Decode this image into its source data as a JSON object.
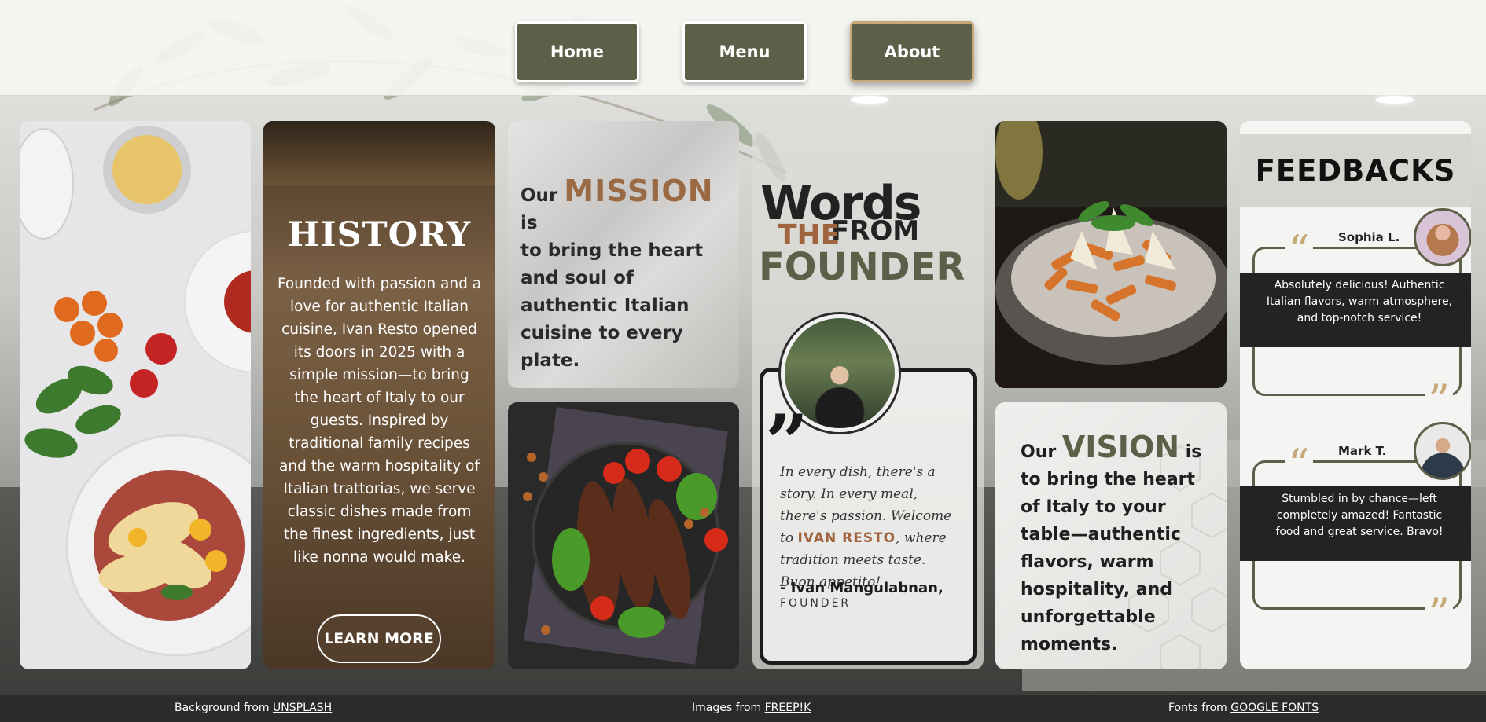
{
  "nav": {
    "items": [
      {
        "label": "Home",
        "active": false
      },
      {
        "label": "Menu",
        "active": false
      },
      {
        "label": "About",
        "active": true
      }
    ]
  },
  "history": {
    "title": "HISTORY",
    "body": "Founded with passion and a love for authentic Italian cuisine, Ivan Resto opened its doors in 2025 with a simple mission—to bring the heart of Italy to our guests. Inspired by traditional family recipes and the warm hospitality of Italian trattorias, we serve classic dishes made from the finest ingredients, just like nonna would make.",
    "button": "LEARN MORE"
  },
  "mission": {
    "prefix": "Our",
    "keyword": "MISSION",
    "suffix": "is",
    "body": "to bring the heart and soul of authentic Italian cuisine to every plate."
  },
  "founder": {
    "heading_words": "Words",
    "heading_from": "FROM",
    "heading_the": "THE",
    "heading_founder": "FOUNDER",
    "quote_part1": "In every dish, there's a story. In every meal, there's passion. Welcome to",
    "quote_brand": "IVAN RESTO",
    "quote_part2": ", where tradition meets taste. Buon appetito!",
    "name": "- Ivan Mangulabnan,",
    "role": "FOUNDER"
  },
  "vision": {
    "prefix": "Our",
    "keyword": "VISION",
    "suffix": "is",
    "body": "to bring the heart of Italy to your table—authentic flavors, warm hospitality, and unforgettable moments."
  },
  "feedbacks": {
    "title": "FEEDBACKS",
    "reviews": [
      {
        "name": "Sophia L.",
        "text": "Absolutely delicious! Authentic Italian flavors, warm atmosphere, and top-notch service!"
      },
      {
        "name": "Mark T.",
        "text": "Stumbled in by chance—left completely amazed! Fantastic food and great service. Bravo!"
      }
    ]
  },
  "footer": {
    "bg_prefix": "Background from",
    "bg_link": "UNSPLASH",
    "img_prefix": "Images from",
    "img_link": "FREEP!K",
    "font_prefix": "Fonts from",
    "font_link": "GOOGLE FONTS"
  },
  "colors": {
    "olive": "#5e5f48",
    "gold": "#c7a877",
    "terracotta": "#9a6a44",
    "dark": "#232323"
  }
}
